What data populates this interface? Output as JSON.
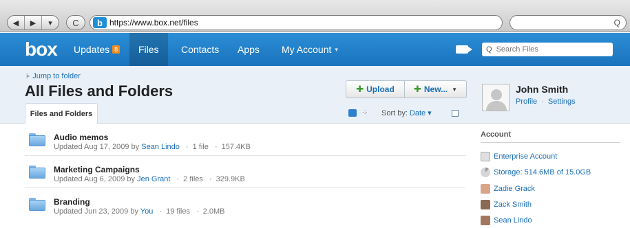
{
  "browser": {
    "url": "https://www.box.net/files",
    "favicon_letter": "b",
    "back_glyph": "◀",
    "forward_glyph": "▶",
    "history_glyph": "▾",
    "reload_glyph": "C",
    "search_glyph": "Q"
  },
  "nav": {
    "logo": "box",
    "items": [
      {
        "label": "Updates",
        "badge": "8"
      },
      {
        "label": "Files"
      },
      {
        "label": "Contacts"
      },
      {
        "label": "Apps"
      },
      {
        "label": "My Account"
      }
    ],
    "search_placeholder": "Search Files",
    "account_chevron": "▾"
  },
  "header": {
    "jump_label": "Jump to folder",
    "title": "All Files and Folders",
    "tab_label": "Files and Folders",
    "upload_label": "Upload",
    "new_label": "New...",
    "sort_label": "Sort by:",
    "sort_value": "Date",
    "sort_chevron": "▾"
  },
  "profile": {
    "name": "John Smith",
    "profile_link": "Profile",
    "separator": "·",
    "settings_link": "Settings"
  },
  "files": [
    {
      "name": "Audio memos",
      "updated": "Updated Aug 17, 2009 by",
      "user": "Sean Lindo",
      "count": "1 file",
      "size": "157.4KB"
    },
    {
      "name": "Marketing Campaigns",
      "updated": "Updated Aug 6, 2009 by",
      "user": "Jen Grant",
      "count": "2 files",
      "size": "329.9KB"
    },
    {
      "name": "Branding",
      "updated": "Updated Jun 23, 2009 by",
      "user": "You",
      "count": "19 files",
      "size": "2.0MB"
    }
  ],
  "meta_separator": "·",
  "sidebar": {
    "title": "Account",
    "items": [
      {
        "label": "Enterprise Account",
        "icon": "enterprise-icon"
      },
      {
        "label": "Storage: 514.6MB of 15.0GB",
        "icon": "storage-pie-icon"
      },
      {
        "label": "Zadie Grack",
        "icon": "user-avatar-icon"
      },
      {
        "label": "Zack Smith",
        "icon": "user-avatar-icon"
      },
      {
        "label": "Sean Lindo",
        "icon": "user-avatar-icon"
      }
    ]
  },
  "colors": {
    "nav_blue": "#1f80c9",
    "link_blue": "#1a6fb8",
    "badge_orange": "#f28a1d",
    "plus_green": "#3b9b2f"
  }
}
